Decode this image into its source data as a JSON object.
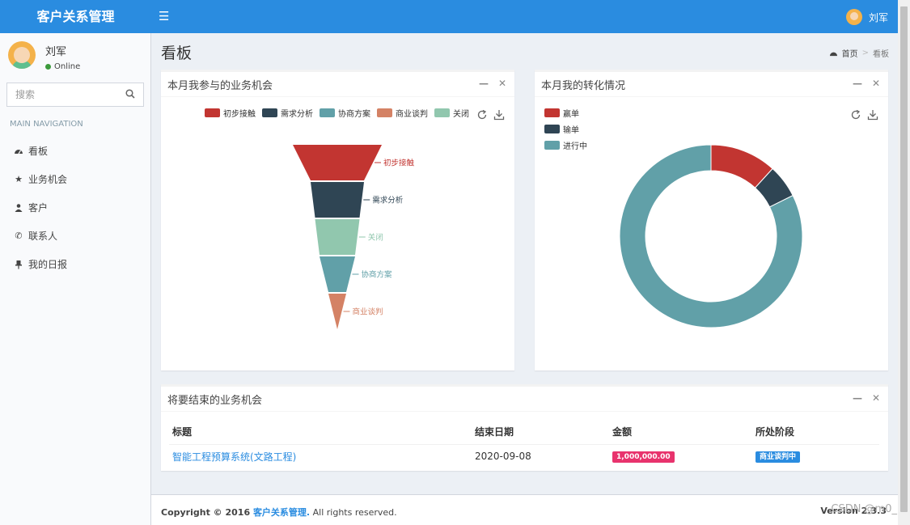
{
  "app": {
    "title": "客户关系管理",
    "menu_icon": "hamburger-icon"
  },
  "user": {
    "name": "刘军",
    "status": "Online"
  },
  "sidebar": {
    "search_placeholder": "搜索",
    "nav_header": "MAIN NAVIGATION",
    "items": [
      {
        "label": "看板",
        "icon": "dashboard-icon"
      },
      {
        "label": "业务机会",
        "icon": "star-icon"
      },
      {
        "label": "客户",
        "icon": "users-icon"
      },
      {
        "label": "联系人",
        "icon": "phone-icon"
      },
      {
        "label": "我的日报",
        "icon": "pin-icon"
      }
    ]
  },
  "page": {
    "title": "看板",
    "breadcrumb": [
      "首页",
      "看板"
    ]
  },
  "colors": {
    "primary": "#2a8ce0",
    "red": "#c23531",
    "navy": "#2f4554",
    "teal": "#61a0a8",
    "salmon": "#d48265",
    "mint": "#91c7ae"
  },
  "funnel_box": {
    "title": "本月我参与的业务机会"
  },
  "donut_box": {
    "title": "本月我的转化情况"
  },
  "chart_data": [
    {
      "type": "funnel",
      "title": "",
      "categories": [
        "初步接触",
        "需求分析",
        "协商方案",
        "商业谈判",
        "关闭"
      ],
      "legend": [
        "初步接触",
        "需求分析",
        "协商方案",
        "商业谈判",
        "关闭"
      ],
      "order_displayed": [
        "初步接触",
        "需求分析",
        "关闭",
        "协商方案",
        "商业谈判"
      ],
      "values": [
        100,
        60,
        40,
        20,
        50
      ],
      "colors": [
        "#c23531",
        "#2f4554",
        "#61a0a8",
        "#d48265",
        "#91c7ae"
      ],
      "legend_position": "top"
    },
    {
      "type": "pie",
      "title": "",
      "style": "donut",
      "categories": [
        "赢单",
        "输单",
        "进行中"
      ],
      "values": [
        1,
        0.5,
        7
      ],
      "colors": [
        "#c23531",
        "#2f4554",
        "#61a0a8"
      ],
      "legend_position": "top-left"
    }
  ],
  "table_box": {
    "title": "将要结束的业务机会",
    "headers": [
      "标题",
      "结束日期",
      "金额",
      "所处阶段"
    ],
    "rows": [
      {
        "title": "智能工程预算系统(文路工程)",
        "end_date": "2020-09-08",
        "amount": "1,000,000.00",
        "stage": "商业谈判中"
      }
    ]
  },
  "footer": {
    "prefix": "Copyright © 2016 ",
    "brand": "客户关系管理.",
    "suffix": " All rights reserved.",
    "version": "Version 2.3.3"
  },
  "watermark": "CSDN @m0_"
}
